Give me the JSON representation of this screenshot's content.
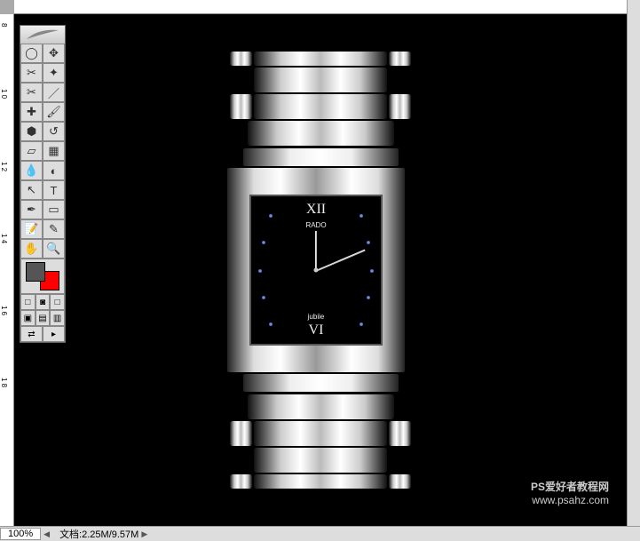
{
  "status": {
    "zoom": "100%",
    "doc_label": "文档:2.25M/9.57M"
  },
  "ruler_v_marks": [
    "8",
    "1 0",
    "1 2",
    "1 4",
    "1 6",
    "1 8"
  ],
  "watermark": {
    "line1": "PS爱好者教程网",
    "line2": "www.psahz.com"
  },
  "watch": {
    "top_numeral": "XII",
    "bottom_numeral": "VI",
    "brand": "RADO",
    "model": "jubiie"
  },
  "colors": {
    "foreground": "#555555",
    "background": "#ff0000"
  },
  "tools": [
    {
      "name": "marquee",
      "glyph": "◯"
    },
    {
      "name": "move",
      "glyph": "✥"
    },
    {
      "name": "lasso",
      "glyph": "✂"
    },
    {
      "name": "magic-wand",
      "glyph": "✦"
    },
    {
      "name": "crop",
      "glyph": "✂"
    },
    {
      "name": "slice",
      "glyph": "／"
    },
    {
      "name": "healing",
      "glyph": "✚"
    },
    {
      "name": "brush",
      "glyph": "🖌"
    },
    {
      "name": "stamp",
      "glyph": "⬢"
    },
    {
      "name": "history-brush",
      "glyph": "↺"
    },
    {
      "name": "eraser",
      "glyph": "▱"
    },
    {
      "name": "gradient",
      "glyph": "▦"
    },
    {
      "name": "blur",
      "glyph": "💧"
    },
    {
      "name": "dodge",
      "glyph": "◐"
    },
    {
      "name": "path-select",
      "glyph": "↖"
    },
    {
      "name": "type",
      "glyph": "T"
    },
    {
      "name": "pen",
      "glyph": "✒"
    },
    {
      "name": "shape",
      "glyph": "▭"
    },
    {
      "name": "notes",
      "glyph": "📝"
    },
    {
      "name": "eyedropper",
      "glyph": "✎"
    },
    {
      "name": "hand",
      "glyph": "✋"
    },
    {
      "name": "zoom",
      "glyph": "🔍"
    }
  ]
}
